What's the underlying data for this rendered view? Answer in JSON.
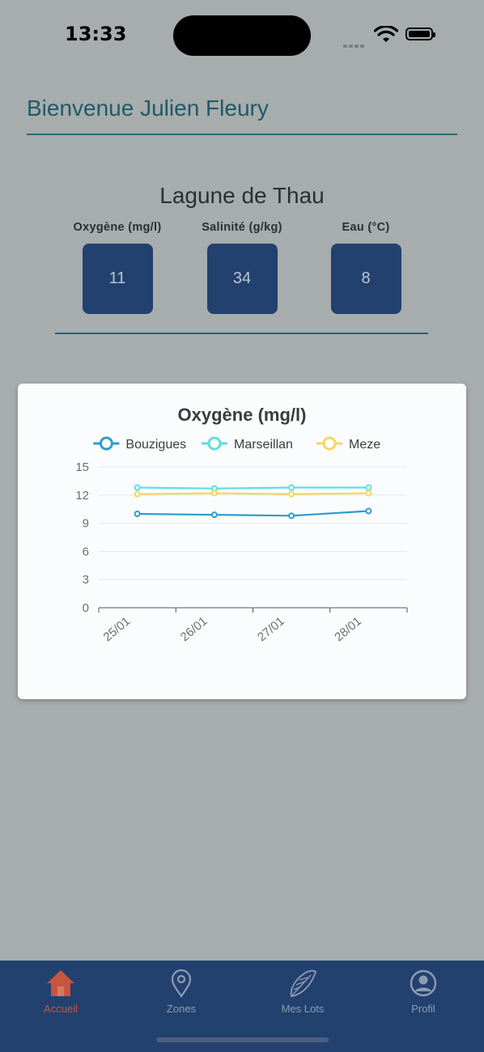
{
  "status": {
    "time": "13:33"
  },
  "header": {
    "welcome": "Bienvenue Julien Fleury"
  },
  "zone": {
    "title": "Lagune de Thau",
    "metrics": [
      {
        "label": "Oxygène (mg/l)",
        "value": "11"
      },
      {
        "label": "Salinité (g/kg)",
        "value": "34"
      },
      {
        "label": "Eau (°C)",
        "value": "8"
      }
    ]
  },
  "colors": {
    "accent": "#23416f",
    "active_tab": "#c8553d",
    "bouzigues": "#2e9bcc",
    "marseillan": "#5fdede",
    "meze": "#f3d75e"
  },
  "chart_data": {
    "type": "line",
    "title": "Oxygène (mg/l)",
    "xlabel": "",
    "ylabel": "",
    "categories": [
      "25/01",
      "26/01",
      "27/01",
      "28/01"
    ],
    "ylim": [
      0,
      15
    ],
    "yticks": [
      "0",
      "3",
      "6",
      "9",
      "12",
      "15"
    ],
    "legend_position": "top",
    "series": [
      {
        "name": "Bouzigues",
        "color": "#2e9bcc",
        "values": [
          10.0,
          9.9,
          9.8,
          10.3
        ]
      },
      {
        "name": "Marseillan",
        "color": "#5fdede",
        "values": [
          12.8,
          12.7,
          12.8,
          12.8
        ]
      },
      {
        "name": "Meze",
        "color": "#f3d75e",
        "values": [
          12.1,
          12.2,
          12.1,
          12.2
        ]
      }
    ]
  },
  "tabs": [
    {
      "label": "Accueil",
      "icon": "home-icon",
      "active": true
    },
    {
      "label": "Zones",
      "icon": "location-pin-icon",
      "active": false
    },
    {
      "label": "Mes Lots",
      "icon": "shell-icon",
      "active": false
    },
    {
      "label": "Profil",
      "icon": "user-circle-icon",
      "active": false
    }
  ]
}
